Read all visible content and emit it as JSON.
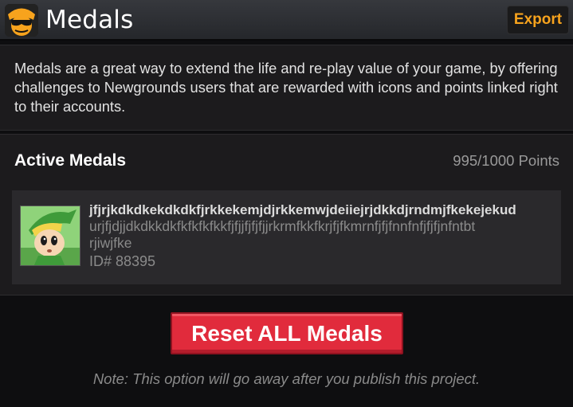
{
  "header": {
    "title": "Medals",
    "export_label": "Export",
    "logo_icon": "newgrounds-logo-icon"
  },
  "description": "Medals are a great way to extend the life and re-play value of your game, by offering challenges to Newgrounds users that are rewarded with icons and points linked right to their accounts.",
  "active_medals": {
    "title": "Active Medals",
    "points": "995/1000 Points",
    "medals": [
      {
        "name": "jfjrjkdkdkekdkdkfjrkkekemjdjrkkemwjdeiiejrjdkkdjrndmjfkekejekud",
        "description_line1": "urjfjdjjdkdkkdkfkfkfkfkkfjfjjfjfjfjjrkrmfkkfkrjfjfkmrnfjfjfnnfnfjfjfjnfntbt",
        "description_line2": "rjiwjfke",
        "id": "ID# 88395",
        "icon": "medal-character-icon"
      }
    ]
  },
  "reset": {
    "label": "Reset ALL Medals",
    "note": "Note: This option will go away after you publish this project."
  },
  "colors": {
    "accent": "#f7a31d",
    "danger": "#e12b3c",
    "panel": "#1c1b1d",
    "background": "#0e0e10"
  }
}
